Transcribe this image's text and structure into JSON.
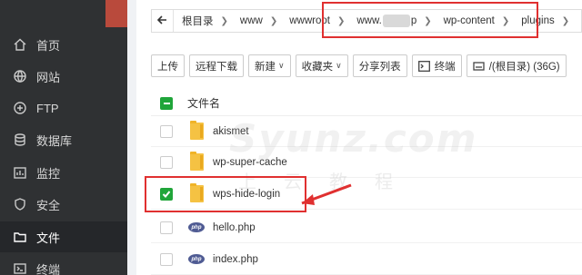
{
  "sidebar": {
    "items": [
      {
        "label": "首页",
        "icon": "home-icon"
      },
      {
        "label": "网站",
        "icon": "globe-icon"
      },
      {
        "label": "FTP",
        "icon": "ftp-icon"
      },
      {
        "label": "数据库",
        "icon": "database-icon"
      },
      {
        "label": "监控",
        "icon": "monitor-icon"
      },
      {
        "label": "安全",
        "icon": "shield-icon"
      },
      {
        "label": "文件",
        "icon": "folder-icon",
        "active": true
      },
      {
        "label": "终端",
        "icon": "terminal-icon"
      }
    ]
  },
  "breadcrumb": {
    "items": [
      "根目录",
      "www",
      "wwwroot",
      "www.",
      "p",
      "wp-content",
      "plugins"
    ]
  },
  "toolbar": {
    "upload": "上传",
    "remote_download": "远程下载",
    "new": "新建",
    "favorites": "收藏夹",
    "share_list": "分享列表",
    "terminal": "终端",
    "disk": "/(根目录) (36G)"
  },
  "table": {
    "header": "文件名",
    "rows": [
      {
        "name": "akismet",
        "type": "folder",
        "checked": false
      },
      {
        "name": "wp-super-cache",
        "type": "folder",
        "checked": false
      },
      {
        "name": "wps-hide-login",
        "type": "folder",
        "checked": true
      },
      {
        "name": "hello.php",
        "type": "php",
        "checked": false
      },
      {
        "name": "index.php",
        "type": "php",
        "checked": false
      }
    ]
  },
  "php_badge": "php",
  "watermark": {
    "main": "Syunz.com",
    "sub": "上云教程"
  },
  "colors": {
    "sidebar_bg": "#2f3133",
    "accent_green": "#20a53a",
    "annotation_red": "#e03030"
  }
}
